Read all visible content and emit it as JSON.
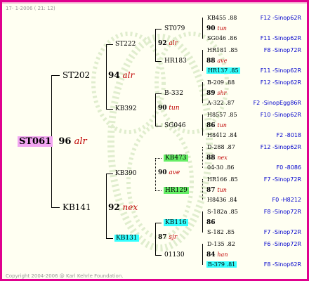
{
  "header": "17-  1-2006 ( 21: 12)",
  "footer": "Copyright 2004-2006 @ Karl Kehrle Foundation.",
  "root": {
    "name": "ST061",
    "value": "96",
    "tag": "alr"
  },
  "gen1": [
    {
      "name": "ST202",
      "value": "94",
      "tag": "alr"
    },
    {
      "name": "KB141",
      "value": "92",
      "tag": "nex"
    }
  ],
  "gen2": [
    {
      "name": "ST222",
      "value": "92",
      "tag": "alr"
    },
    {
      "name": "KB392",
      "value": "90",
      "tag": "tun"
    },
    {
      "name": "KB390",
      "value": "90",
      "tag": "ave"
    },
    {
      "name": "KB131",
      "value": "87",
      "tag": "sjr"
    }
  ],
  "gen3": [
    {
      "name": "ST079",
      "value": "90",
      "tag": "tun"
    },
    {
      "name": "HR183",
      "value": "88",
      "tag": "ave"
    },
    {
      "name": "B-332",
      "value": "89",
      "tag": "shr"
    },
    {
      "name": "SG046",
      "value": "86",
      "tag": "tun"
    },
    {
      "name": "KB473",
      "value": "88",
      "tag": "nex"
    },
    {
      "name": "HR129",
      "value": "87",
      "tag": "tun"
    },
    {
      "name": "KB116",
      "value": "86",
      "tag": ""
    },
    {
      "name": "01130",
      "value": "84",
      "tag": "han"
    }
  ],
  "gen4": [
    {
      "name": "KB455 .88",
      "line": "F12 -Sinop62R"
    },
    {
      "name": "SG046 .86",
      "line": "F11 -Sinop62R"
    },
    {
      "name": "HR181 .85",
      "line": "F8 -Sinop72R"
    },
    {
      "name": "HR137 .85",
      "line": "F11 -Sinop62R"
    },
    {
      "name": "B-209 .88",
      "line": "F12 -Sinop62R"
    },
    {
      "name": "A-322 .87",
      "line": "F2 -SinopEgg86R"
    },
    {
      "name": "H8557 .85",
      "line": "F10 -Sinop62R"
    },
    {
      "name": "H8412 .84",
      "line": "F2 -8018"
    },
    {
      "name": "D-288 .87",
      "line": "F12 -Sinop62R"
    },
    {
      "name": "04-30 .86",
      "line": "F0 -8086"
    },
    {
      "name": "HR166 .85",
      "line": "F7 -Sinop72R"
    },
    {
      "name": "H8436 .84",
      "line": "F0 -H8212"
    },
    {
      "name": "S-182a .85",
      "line": "F8 -Sinop72R"
    },
    {
      "name": "S-182 .85",
      "line": "F7 -Sinop72R"
    },
    {
      "name": "D-135 .82",
      "line": "F6 -Sinop72R"
    },
    {
      "name": "B-379 .81",
      "line": "F8 -Sinop62R"
    }
  ]
}
